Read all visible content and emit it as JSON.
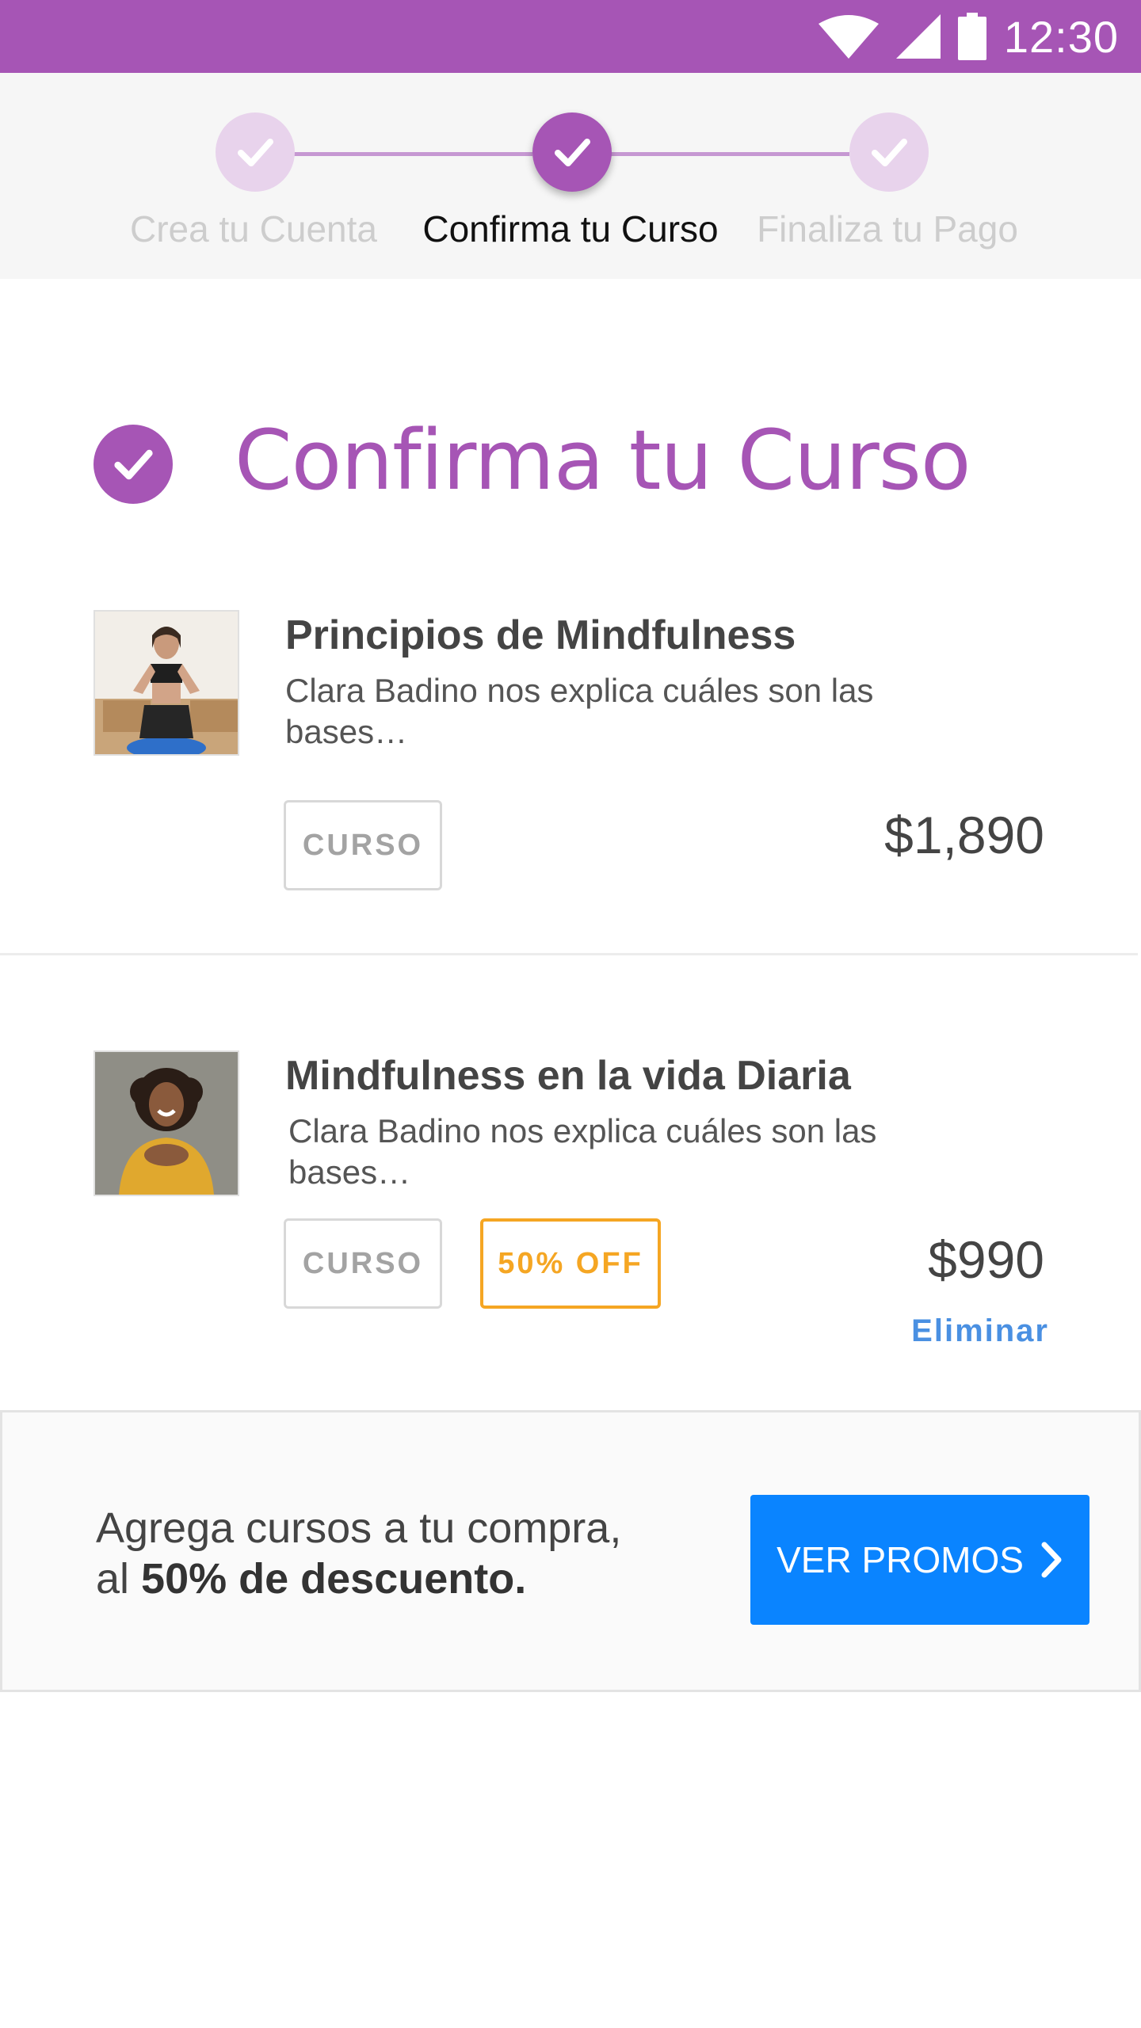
{
  "status_bar": {
    "time": "12:30",
    "icons": [
      "wifi-icon",
      "cell-signal-icon",
      "battery-icon"
    ],
    "color": "#a655b5"
  },
  "stepper": {
    "steps": [
      {
        "label": "Crea tu Cuenta",
        "state": "done"
      },
      {
        "label": "Confirma tu Curso",
        "state": "active"
      },
      {
        "label": "Finaliza tu Pago",
        "state": "pending"
      }
    ]
  },
  "page": {
    "title": "Confirma tu Curso"
  },
  "courses": [
    {
      "title": "Principios de Mindfulness",
      "description": "Clara Badino nos explica cuáles son las bases…",
      "tags": [
        "CURSO"
      ],
      "price": "$1,890"
    },
    {
      "title": "Mindfulness en la vida Diaria",
      "description": "Clara Badino nos explica cuáles son las bases…",
      "tags": [
        "CURSO",
        "50% OFF"
      ],
      "price": "$990",
      "remove_label": "Eliminar"
    }
  ],
  "promo": {
    "text_line1": "Agrega cursos a tu compra,",
    "text_line2_prefix": "al ",
    "text_line2_bold": "50% de descuento.",
    "button_label": "VER PROMOS"
  },
  "colors": {
    "brand_purple": "#a655b5",
    "button_blue": "#0a84ff",
    "discount_orange": "#f5a623",
    "link_blue": "#4a90e2"
  }
}
